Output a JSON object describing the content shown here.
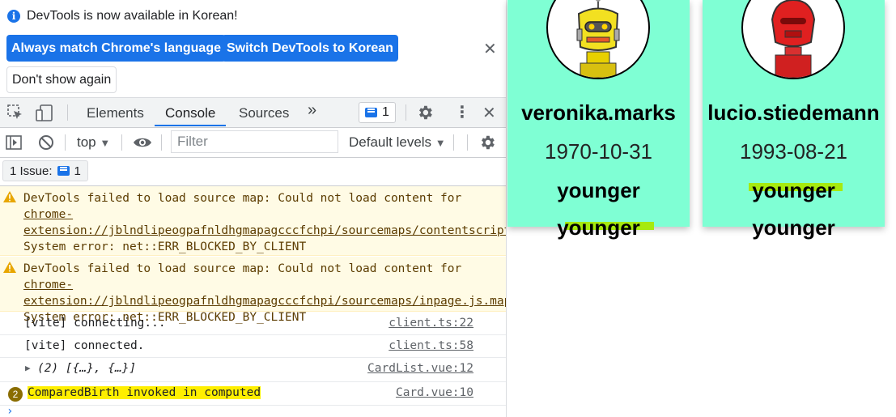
{
  "devtools": {
    "notice": {
      "info_text": "DevTools is now available in Korean!",
      "btn_match": "Always match Chrome's language",
      "btn_switch": "Switch DevTools to Korean",
      "btn_dont_show": "Don't show again"
    },
    "tabs": [
      {
        "label": "Elements"
      },
      {
        "label": "Console"
      },
      {
        "label": "Sources"
      }
    ],
    "active_tab": "Console",
    "message_count": "1",
    "toolbar": {
      "context": "top",
      "filter_placeholder": "Filter",
      "levels": "Default levels"
    },
    "issues": {
      "label": "1 Issue:",
      "count": "1"
    },
    "logs": [
      {
        "type": "warning",
        "prefix": "DevTools failed to load source map: Could not load content for ",
        "link": "chrome-extension://jblndlipeogpafnldhgmapagcccfchpi/sourcemaps/contentscript.js.map",
        "suffix": ": System error: net::ERR_BLOCKED_BY_CLIENT"
      },
      {
        "type": "warning",
        "prefix": "DevTools failed to load source map: Could not load content for ",
        "link": "chrome-extension://jblndlipeogpafnldhgmapagcccfchpi/sourcemaps/inpage.js.map",
        "suffix": ": System error: net::ERR_BLOCKED_BY_CLIENT"
      },
      {
        "type": "log",
        "text": "[vite] connecting...",
        "source": "client.ts:22"
      },
      {
        "type": "log",
        "text": "[vite] connected.",
        "source": "client.ts:58"
      },
      {
        "type": "object",
        "text": "(2) [{…}, {…}]",
        "source": "CardList.vue:12"
      },
      {
        "type": "log",
        "repeat": "2",
        "text": "ComparedBirth invoked in computed",
        "source": "Card.vue:10"
      }
    ]
  },
  "cards": [
    {
      "username": "veronika.marks",
      "birthdate": "1970-10-31",
      "compare1": "younger",
      "compare2": "younger",
      "robot_color": "#f2e021"
    },
    {
      "username": "lucio.stiedemann",
      "birthdate": "1993-08-21",
      "compare1": "younger",
      "compare2": "younger",
      "robot_color": "#e02020"
    }
  ],
  "colors": {
    "card_bg": "#7fffd4",
    "highlight_green": "#a6ea0e",
    "highlight_yellow": "#ffef00",
    "devtools_blue": "#1a73e8"
  }
}
